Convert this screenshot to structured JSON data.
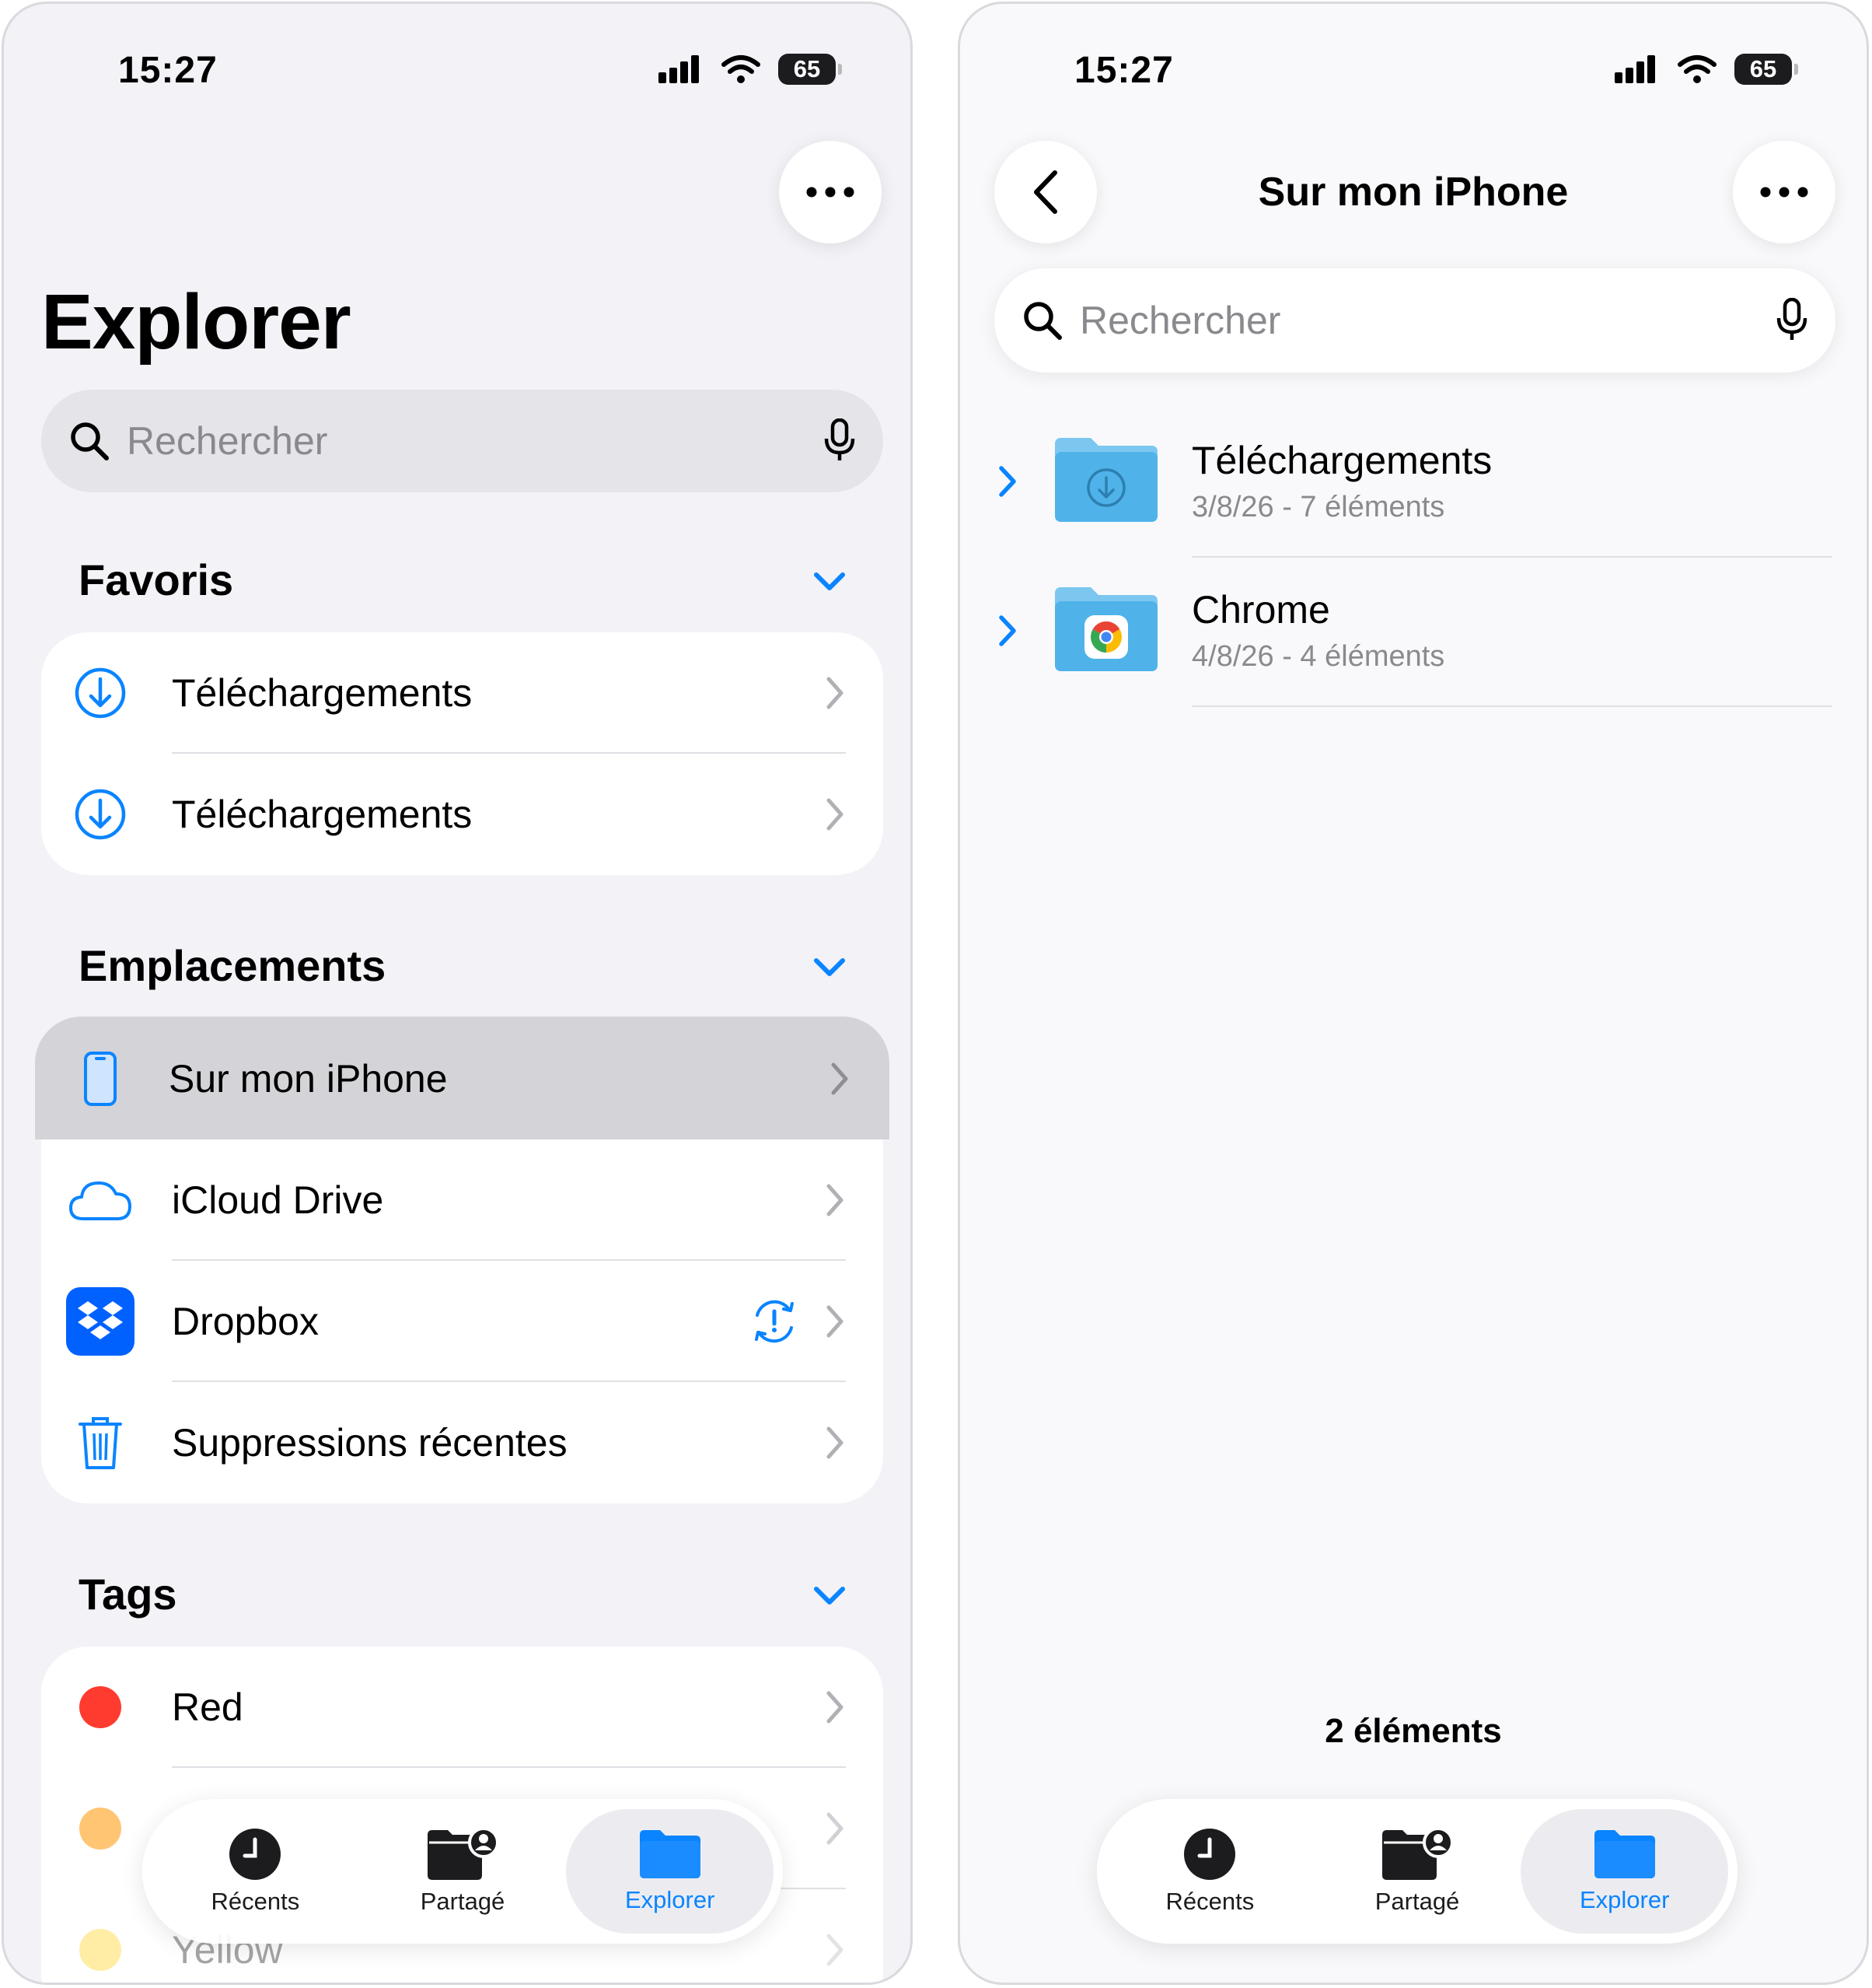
{
  "colors": {
    "accent": "#0a84ff",
    "folder_blue": "#4fb3ea",
    "dropbox_blue": "#0061fe",
    "tag_red": "#ff3b30",
    "tag_orange": "#ff9500",
    "tag_yellow": "#ffcc00"
  },
  "left": {
    "status": {
      "time": "15:27",
      "battery": "65"
    },
    "more_icon": "ellipsis-icon",
    "title": "Explorer",
    "search": {
      "placeholder": "Rechercher"
    },
    "favorites": {
      "title": "Favoris",
      "items": [
        {
          "label": "Téléchargements",
          "icon": "download-circle-icon"
        },
        {
          "label": "Téléchargements",
          "icon": "download-circle-icon"
        }
      ]
    },
    "locations": {
      "title": "Emplacements",
      "items": [
        {
          "label": "Sur mon iPhone",
          "icon": "iphone-icon",
          "selected": true
        },
        {
          "label": "iCloud Drive",
          "icon": "icloud-icon"
        },
        {
          "label": "Dropbox",
          "icon": "dropbox-icon",
          "badge_icon": "sync-warning-icon"
        },
        {
          "label": "Suppressions récentes",
          "icon": "trash-icon"
        }
      ]
    },
    "tags": {
      "title": "Tags",
      "items": [
        {
          "label": "Red",
          "color": "#ff3b30"
        },
        {
          "label": "",
          "color": "#ff9500"
        },
        {
          "label": "Yellow",
          "color": "#ffcc00"
        }
      ]
    },
    "tabbar": [
      {
        "label": "Récents",
        "icon": "clock-icon",
        "active": false
      },
      {
        "label": "Partagé",
        "icon": "shared-folder-icon",
        "active": false
      },
      {
        "label": "Explorer",
        "icon": "folder-icon",
        "active": true
      }
    ]
  },
  "right": {
    "status": {
      "time": "15:27",
      "battery": "65"
    },
    "nav_title": "Sur mon iPhone",
    "search": {
      "placeholder": "Rechercher"
    },
    "folders": [
      {
        "name": "Téléchargements",
        "meta": "3/8/26 - 7 éléments",
        "icon": "downloads-folder-icon"
      },
      {
        "name": "Chrome",
        "meta": "4/8/26 - 4 éléments",
        "icon": "chrome-folder-icon"
      }
    ],
    "footer_count": "2 éléments",
    "tabbar": [
      {
        "label": "Récents",
        "icon": "clock-icon",
        "active": false
      },
      {
        "label": "Partagé",
        "icon": "shared-folder-icon",
        "active": false
      },
      {
        "label": "Explorer",
        "icon": "folder-icon",
        "active": true
      }
    ]
  }
}
